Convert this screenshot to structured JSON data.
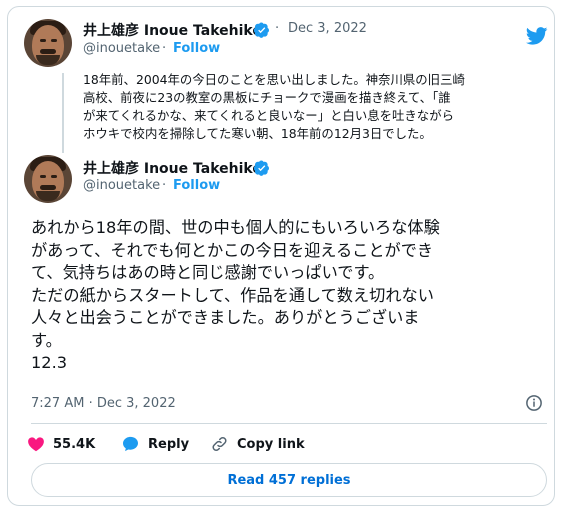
{
  "brand_color": "#1d9bf0",
  "quoted_tweet": {
    "author_name": "井上雄彦 Inoue Takehiko",
    "separator": "·",
    "date": "Dec 3, 2022",
    "handle": "@inouetake",
    "follow_label": "Follow",
    "text": "18年前、2004年の今日のことを思い出しました。神奈川県の旧三崎\n高校、前夜に23の教室の黒板にチョークで漫画を描き終えて、「誰\nが来てくれるかな、来てくれると良いなー」と白い息を吐きながら\nホウキで校内を掃除してた寒い朝、18年前の12月3日でした。"
  },
  "main_tweet": {
    "author_name": "井上雄彦 Inoue Takehiko",
    "handle": "@inouetake",
    "follow_label": "Follow",
    "text": "あれから18年の間、世の中も個人的にもいろいろな体験\nがあって、それでも何とかこの今日を迎えることができ\nて、気持ちはあの時と同じ感謝でいっぱいです。\nただの紙からスタートして、作品を通して数え切れない\n人々と出会うことができました。ありがとうございま\nす。\n12.3",
    "timestamp": "7:27 AM · Dec 3, 2022"
  },
  "actions": {
    "likes": "55.4K",
    "reply_label": "Reply",
    "copy_link_label": "Copy link"
  },
  "read_replies_label": "Read 457 replies",
  "icons": [
    "twitter-bird-icon",
    "verified-badge-icon",
    "info-icon",
    "heart-icon",
    "reply-icon",
    "link-icon"
  ]
}
